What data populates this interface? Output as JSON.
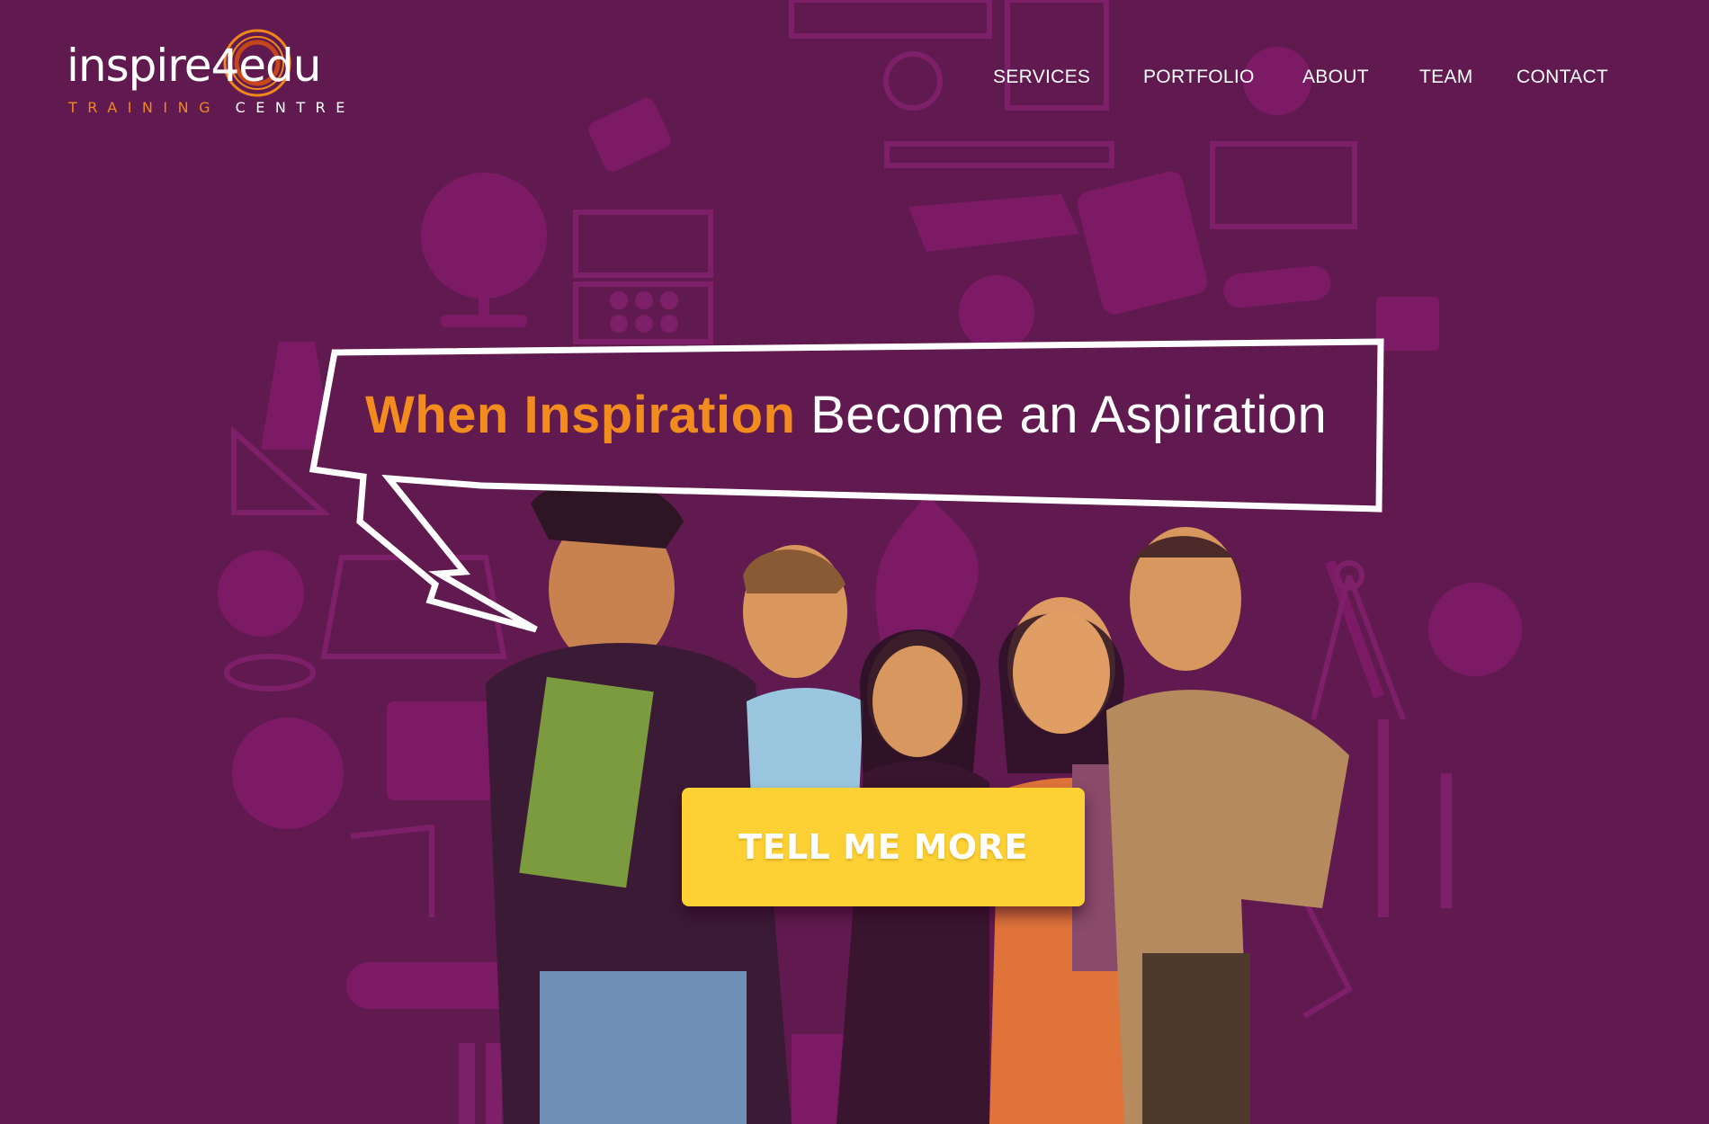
{
  "logo": {
    "name_start": "inspire",
    "name_digit": "4",
    "name_end": "edu",
    "sub_orange": "TRAINING",
    "sub_white": "CENTRE"
  },
  "nav": {
    "items": [
      {
        "label": "SERVICES"
      },
      {
        "label": "PORTFOLIO"
      },
      {
        "label": "ABOUT"
      },
      {
        "label": "TEAM"
      },
      {
        "label": "CONTACT"
      }
    ]
  },
  "hero": {
    "headline_orange": "When Inspiration",
    "headline_white": "Become an Aspiration",
    "cta_label": "TELL ME MORE"
  },
  "colors": {
    "background": "#611a4f",
    "accent_orange": "#f28c1e",
    "cta_yellow": "#fdd033"
  }
}
